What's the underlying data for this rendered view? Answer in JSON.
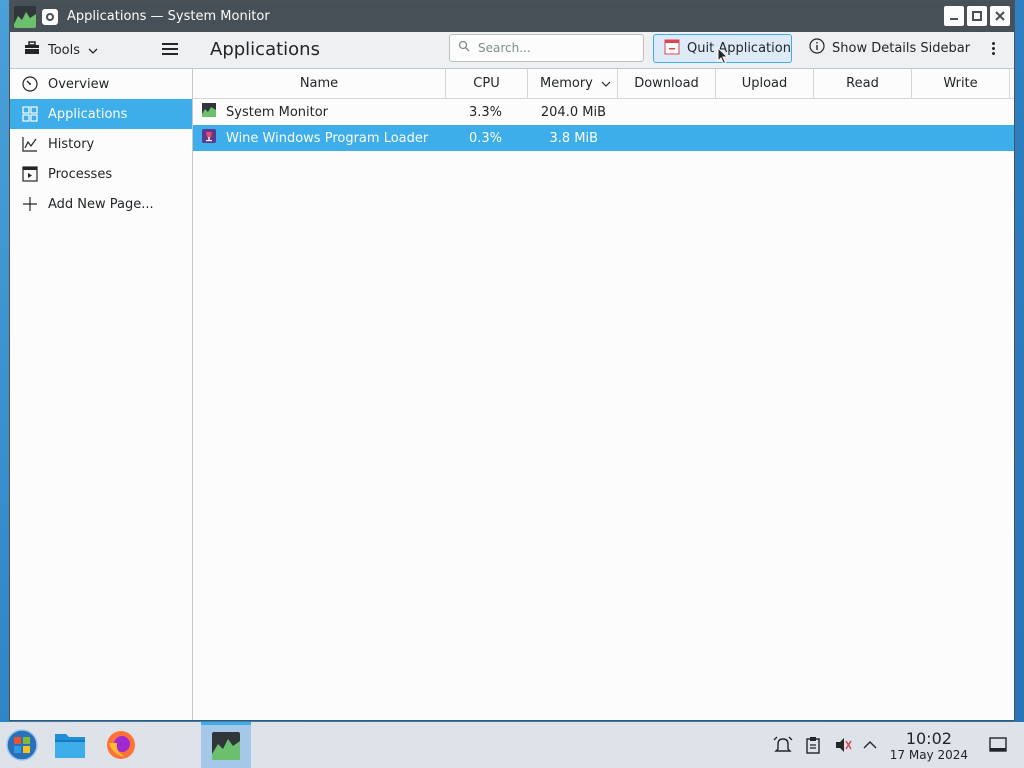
{
  "window": {
    "title": "Applications — System Monitor"
  },
  "toolbar": {
    "tools_label": "Tools",
    "page_title": "Applications",
    "search_placeholder": "Search...",
    "quit_label": "Quit Application",
    "details_label": "Show Details Sidebar"
  },
  "sidebar": {
    "items": [
      {
        "label": "Overview",
        "icon": "speedometer-icon",
        "selected": false
      },
      {
        "label": "Applications",
        "icon": "grid-icon",
        "selected": true
      },
      {
        "label": "History",
        "icon": "chart-line-icon",
        "selected": false
      },
      {
        "label": "Processes",
        "icon": "terminal-window-icon",
        "selected": false
      },
      {
        "label": "Add New Page...",
        "icon": "plus-icon",
        "selected": false
      }
    ]
  },
  "table": {
    "columns": [
      "Name",
      "CPU",
      "Memory",
      "Download",
      "Upload",
      "Read",
      "Write"
    ],
    "sorted_column": "Memory",
    "rows": [
      {
        "name": "System Monitor",
        "cpu": "3.3%",
        "memory": "204.0 MiB",
        "download": "",
        "upload": "",
        "read": "",
        "write": "",
        "selected": false
      },
      {
        "name": "Wine Windows Program Loader",
        "cpu": "0.3%",
        "memory": "3.8 MiB",
        "download": "",
        "upload": "",
        "read": "",
        "write": "",
        "selected": true
      }
    ]
  },
  "taskbar": {
    "time": "10:02",
    "date": "17 May 2024"
  },
  "colors": {
    "accent": "#3daee9",
    "titlebar": "#475057",
    "window_bg": "#eff0f1",
    "view_bg": "#fcfcfc"
  }
}
